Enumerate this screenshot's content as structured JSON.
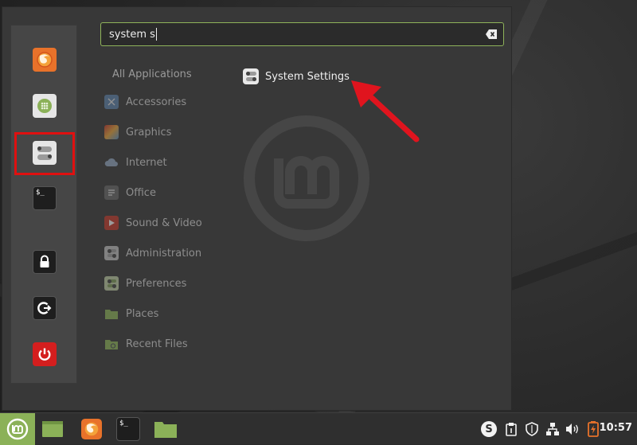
{
  "search": {
    "value": "system s"
  },
  "categories": {
    "all_label": "All Applications",
    "items": [
      {
        "label": "Accessories",
        "color": "#5b7fa8"
      },
      {
        "label": "Graphics",
        "color": "#c06a3a"
      },
      {
        "label": "Internet",
        "color": "#6f86a3"
      },
      {
        "label": "Office",
        "color": "#777777"
      },
      {
        "label": "Sound & Video",
        "color": "#c0392b"
      },
      {
        "label": "Administration",
        "color": "#8f8f8f"
      },
      {
        "label": "Preferences",
        "color": "#7d9a5a"
      },
      {
        "label": "Places",
        "color": "#8bb158"
      },
      {
        "label": "Recent Files",
        "color": "#8bb158"
      }
    ]
  },
  "result": {
    "label": "System Settings"
  },
  "sidebar": {
    "items": [
      {
        "name": "firefox",
        "icon": "firefox-icon"
      },
      {
        "name": "software-manager",
        "icon": "software-manager-icon"
      },
      {
        "name": "system-settings",
        "icon": "settings-toggle-icon"
      },
      {
        "name": "terminal",
        "icon": "terminal-icon",
        "glyph": "$_"
      },
      {
        "name": "lock-screen",
        "icon": "lock-icon"
      },
      {
        "name": "logout",
        "icon": "logout-icon"
      },
      {
        "name": "shutdown",
        "icon": "power-icon"
      }
    ]
  },
  "taskbar": {
    "terminal_glyph": "$_",
    "tray_skype_glyph": "S",
    "clock": "10:57"
  },
  "colors": {
    "accent": "#8bb158",
    "highlight": "#e01010",
    "arrow": "#e0141e",
    "menu_bg": "#383838"
  }
}
